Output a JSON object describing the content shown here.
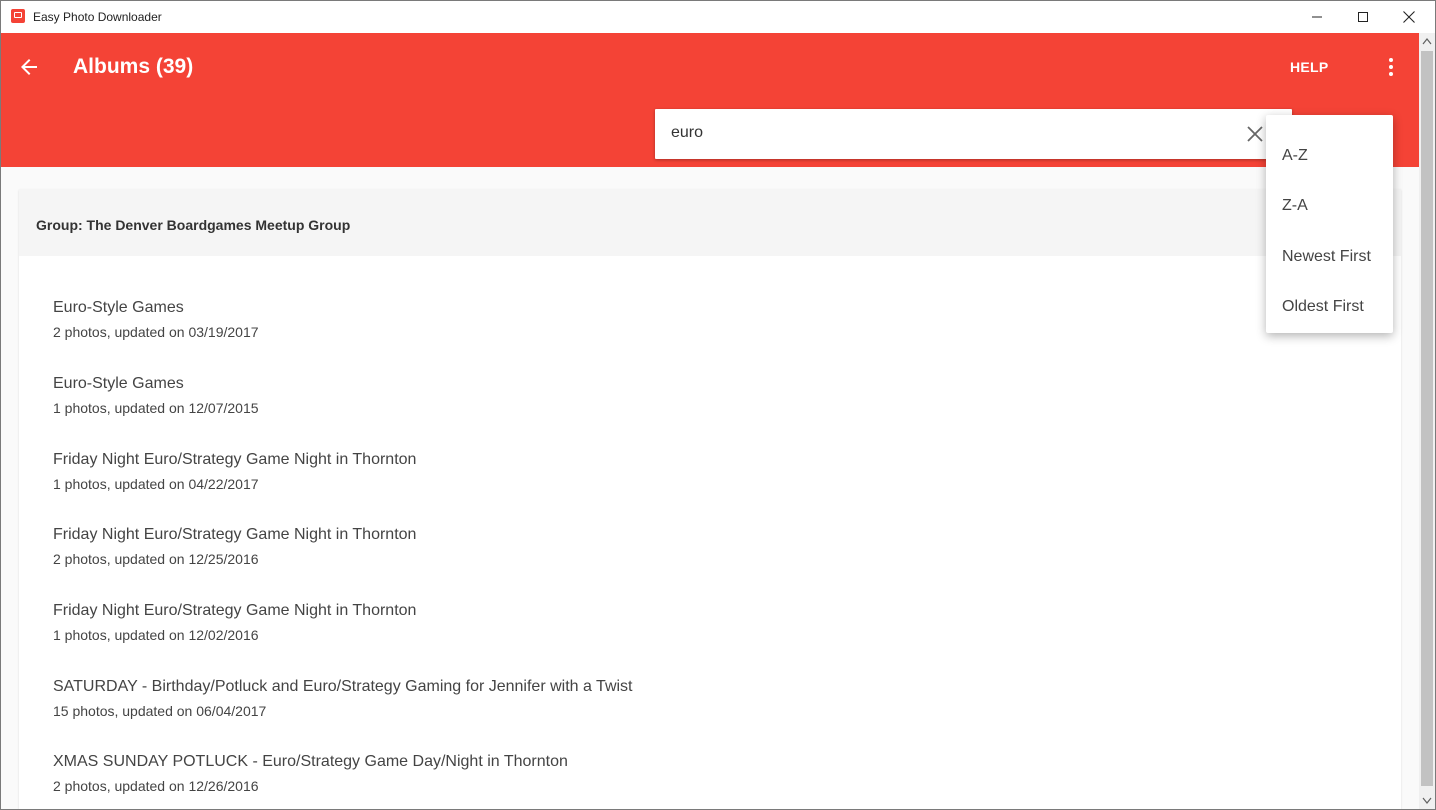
{
  "window": {
    "title": "Easy Photo Downloader"
  },
  "appbar": {
    "title": "Albums (39)",
    "help_label": "HELP",
    "background": "#f44336"
  },
  "search": {
    "value": "euro"
  },
  "group": {
    "title": "Group: The Denver Boardgames Meetup Group"
  },
  "albums": [
    {
      "name": "Euro-Style Games",
      "meta": "2 photos, updated on 03/19/2017"
    },
    {
      "name": "Euro-Style Games",
      "meta": "1 photos, updated on 12/07/2015"
    },
    {
      "name": "Friday Night Euro/Strategy Game Night in Thornton",
      "meta": "1 photos, updated on 04/22/2017"
    },
    {
      "name": "Friday Night Euro/Strategy Game Night in Thornton",
      "meta": "2 photos, updated on 12/25/2016"
    },
    {
      "name": "Friday Night Euro/Strategy Game Night in Thornton",
      "meta": "1 photos, updated on 12/02/2016"
    },
    {
      "name": "SATURDAY - Birthday/Potluck and Euro/Strategy Gaming for Jennifer with a Twist",
      "meta": "15 photos, updated on 06/04/2017"
    },
    {
      "name": "XMAS SUNDAY POTLUCK - Euro/Strategy Game Day/Night in Thornton",
      "meta": "2 photos, updated on 12/26/2016"
    }
  ],
  "sort_menu": {
    "items": [
      "A-Z",
      "Z-A",
      "Newest First",
      "Oldest First"
    ]
  }
}
